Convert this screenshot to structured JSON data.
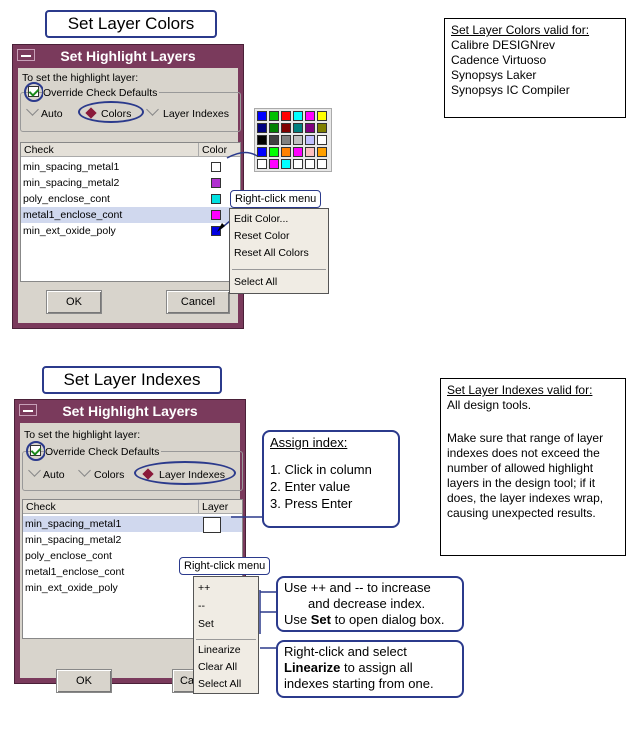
{
  "section1": {
    "heading": "Set Layer Colors",
    "info_title": "Set Layer Colors valid for:",
    "info_lines": [
      "Calibre DESIGNrev",
      "Cadence Virtuoso",
      "Synopsys Laker",
      "Synopsys IC Compiler"
    ],
    "dialog": {
      "title": "Set Highlight Layers",
      "prompt": "To set the highlight layer:",
      "override_label": "Override Check Defaults",
      "override_checked": true,
      "modes": [
        "Auto",
        "Colors",
        "Layer Indexes"
      ],
      "selected_mode": "Colors",
      "columns": [
        "Check",
        "Color"
      ],
      "rows": [
        {
          "check": "min_spacing_metal1",
          "color": "#ffffff"
        },
        {
          "check": "min_spacing_metal2",
          "color": "#b030d0"
        },
        {
          "check": "poly_enclose_cont",
          "color": "#00e0e0"
        },
        {
          "check": "metal1_enclose_cont",
          "color": "#ff00ff"
        },
        {
          "check": "min_ext_oxide_poly",
          "color": "#0000e0"
        }
      ],
      "ok": "OK",
      "cancel": "Cancel"
    },
    "rightclick_label": "Right-click menu",
    "menu": [
      "Edit Color...",
      "Reset Color",
      "Reset All Colors",
      "Select All"
    ]
  },
  "section2": {
    "heading": "Set Layer Indexes",
    "info_title": "Set Layer Indexes valid for:",
    "info_line1": "All design tools.",
    "info_body": "Make sure that range of layer indexes does not exceed the number of allowed highlight layers in the design tool; if it does, the layer indexes wrap, causing unexpected results.",
    "dialog": {
      "title": "Set Highlight Layers",
      "prompt": "To set the highlight layer:",
      "override_label": "Override Check Defaults",
      "modes": [
        "Auto",
        "Colors",
        "Layer Indexes"
      ],
      "selected_mode": "Layer Indexes",
      "columns": [
        "Check",
        "Layer"
      ],
      "rows": [
        "min_spacing_metal1",
        "min_spacing_metal2",
        "poly_enclose_cont",
        "metal1_enclose_cont",
        "min_ext_oxide_poly"
      ],
      "ok": "OK",
      "cancel_partial": "Ca"
    },
    "rightclick_label": "Right-click menu",
    "menu": [
      "++",
      "--",
      "Set",
      "Linearize",
      "Clear All",
      "Select All"
    ],
    "assign_title": "Assign index:",
    "assign_steps": [
      "1. Click in column",
      "2. Enter value",
      "3. Press Enter"
    ],
    "callout_inc_1": "Use ++ and -- to increase",
    "callout_inc_2": "and decrease index.",
    "callout_inc_3a": "Use ",
    "callout_inc_3b": "Set",
    "callout_inc_3c": " to open dialog box.",
    "callout_lin_1": "Right-click and select",
    "callout_lin_2a": "Linearize",
    "callout_lin_2b": " to assign all",
    "callout_lin_3": "indexes starting from one."
  },
  "palette": [
    "#0000ff",
    "#00c000",
    "#ff0000",
    "#00ffff",
    "#ff00ff",
    "#ffff00",
    "#000080",
    "#008000",
    "#800000",
    "#008080",
    "#800080",
    "#808000",
    "#000000",
    "#404040",
    "#808080",
    "#c0c0c0",
    "#c0c0ff",
    "#ffffff",
    "#0000ff",
    "#00ff00",
    "#ff8000",
    "#ff00ff",
    "#ffc0c0",
    "#ffa000",
    "#ffffff",
    "#ff00ff",
    "#00ffff",
    "#ffffff",
    "#ffffff",
    "#ffffff"
  ]
}
